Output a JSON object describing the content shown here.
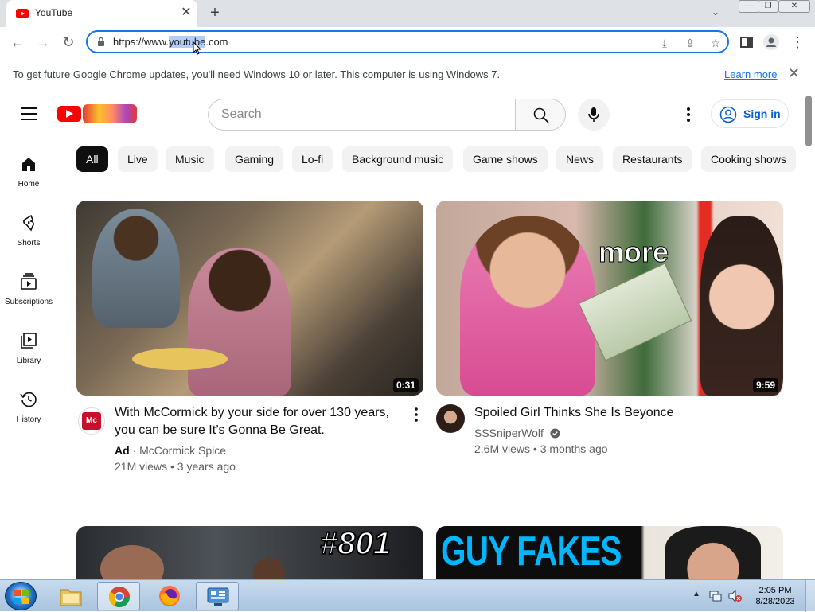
{
  "browser": {
    "tab_title": "YouTube",
    "url_prefix": "https://www.",
    "url_selected": "youtube",
    "url_suffix": ".com"
  },
  "infobar": {
    "message": "To get future Google Chrome updates, you'll need Windows 10 or later. This computer is using Windows 7.",
    "learn_more": "Learn more"
  },
  "masthead": {
    "search_placeholder": "Search",
    "sign_in": "Sign in"
  },
  "guide": {
    "items": [
      {
        "label": "Home"
      },
      {
        "label": "Shorts"
      },
      {
        "label": "Subscriptions"
      },
      {
        "label": "Library"
      },
      {
        "label": "History"
      }
    ]
  },
  "chips": [
    "All",
    "Live",
    "Music",
    "Gaming",
    "Lo-fi",
    "Background music",
    "Game shows",
    "News",
    "Restaurants",
    "Cooking shows"
  ],
  "videos": [
    {
      "duration": "0:31",
      "title_line1": "With McCormick by your side for over 130 years,",
      "title_line2": "you can be sure It’s Gonna Be Great.",
      "ad_badge": "Ad",
      "channel": "McCormick Spice",
      "stats": "21M views • 3 years ago",
      "avatar_text": "Mc"
    },
    {
      "duration": "9:59",
      "title_line1": "Spoiled Girl Thinks She Is Beyonce",
      "channel": "SSSniperWolf",
      "stats": "2.6M views • 3 months ago",
      "overlay_text": "more"
    },
    {
      "overlay_text": "#801"
    },
    {
      "overlay_text": "GUY FAKES"
    }
  ],
  "taskbar": {
    "time": "2:05 PM",
    "date": "8/28/2023"
  }
}
